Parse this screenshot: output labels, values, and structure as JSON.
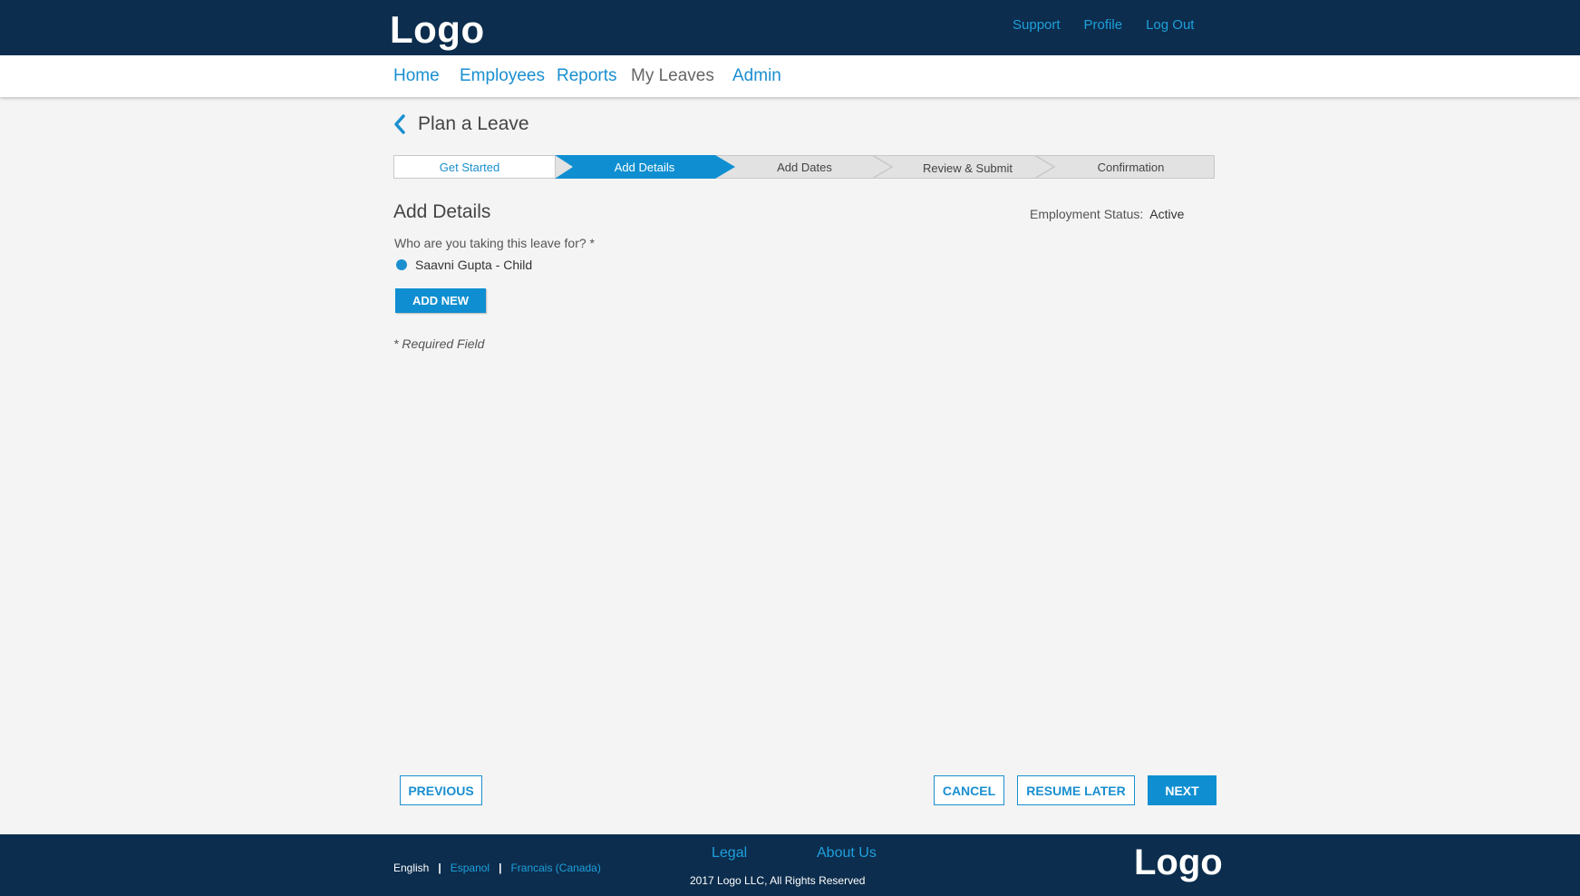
{
  "header": {
    "logo": "Logo",
    "links": [
      "Support",
      "Profile",
      "Log Out"
    ]
  },
  "nav": {
    "items": [
      {
        "label": "Home",
        "active": false
      },
      {
        "label": "Employees",
        "active": false
      },
      {
        "label": "Reports",
        "active": false
      },
      {
        "label": "My Leaves",
        "active": true
      },
      {
        "label": "Admin",
        "active": false
      }
    ]
  },
  "page": {
    "title": "Plan a Leave"
  },
  "stepper": {
    "steps": [
      "Get Started",
      "Add Details",
      "Add Dates",
      "Review & Submit",
      "Confirmation"
    ],
    "current_step": "Add Details"
  },
  "details": {
    "section_title": "Add Details",
    "employment_status_label": "Employment Status:",
    "employment_status_value": "Active",
    "question": "Who are you taking this leave for? *",
    "selected_person": "Saavni Gupta - Child",
    "add_new_label": "ADD NEW",
    "required_note": "* Required Field"
  },
  "actions": {
    "previous": "PREVIOUS",
    "cancel": "CANCEL",
    "resume_later": "RESUME LATER",
    "next": "NEXT"
  },
  "footer": {
    "languages": [
      "English",
      "Espanol",
      "Francais (Canada)"
    ],
    "links": [
      "Legal",
      "About Us"
    ],
    "copyright": "2017 Logo LLC, All Rights Reserved",
    "logo": "Logo"
  },
  "colors": {
    "header_bg": "#0c2d4d",
    "accent": "#0f8fd1",
    "page_bg": "#f4f4f4"
  }
}
